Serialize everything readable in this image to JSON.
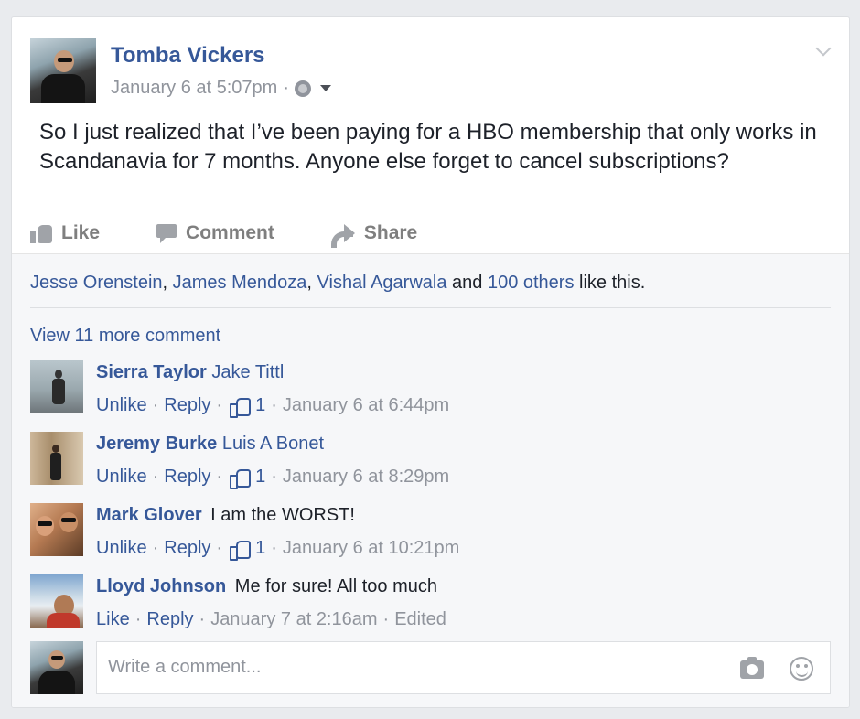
{
  "post": {
    "author": "Tomba Vickers",
    "timestamp": "January 6 at 5:07pm",
    "meta_separator": "·",
    "privacy_icon": "globe-icon",
    "text": "So I just realized that I’ve been paying for a HBO membership that only works in Scandanavia for 7 months. Anyone else forget to cancel subscriptions?",
    "actions": {
      "like": "Like",
      "comment": "Comment",
      "share": "Share"
    }
  },
  "likes": {
    "names": [
      "Jesse Orenstein",
      "James Mendoza",
      "Vishal Agarwala"
    ],
    "sep1": ", ",
    "sep2": ", ",
    "and": " and ",
    "others": "100 others",
    "suffix": " like this."
  },
  "view_more": "View 11 more comment",
  "comments": [
    {
      "name": "Sierra Taylor",
      "text": "Jake Tittl",
      "text_is_link": true,
      "action1": "Unlike",
      "action2": "Reply",
      "likes": "1",
      "time": "January 6 at 6:44pm",
      "edited": ""
    },
    {
      "name": "Jeremy Burke",
      "text": "Luis A Bonet",
      "text_is_link": true,
      "action1": "Unlike",
      "action2": "Reply",
      "likes": "1",
      "time": "January 6 at 8:29pm",
      "edited": ""
    },
    {
      "name": "Mark Glover",
      "text": "I am the WORST!",
      "text_is_link": false,
      "action1": "Unlike",
      "action2": "Reply",
      "likes": "1",
      "time": "January 6 at 10:21pm",
      "edited": ""
    },
    {
      "name": "Lloyd Johnson",
      "text": "Me for sure! All too much",
      "text_is_link": false,
      "action1": "Like",
      "action2": "Reply",
      "likes": "",
      "time": "January 7 at 2:16am",
      "edited": "Edited"
    }
  ],
  "composer": {
    "placeholder": "Write a comment..."
  },
  "colors": {
    "link": "#365899",
    "meta": "#90949c",
    "background": "#e9ebee"
  }
}
